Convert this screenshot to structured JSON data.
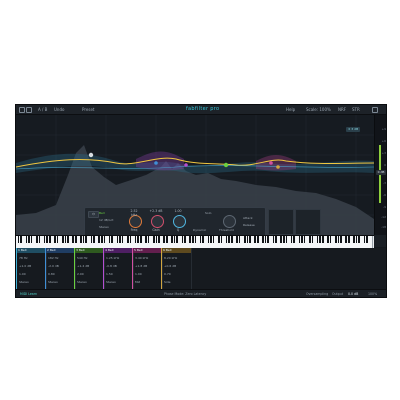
{
  "app": {
    "brand": "fabfilter pro",
    "top_left_items": [
      "A / B",
      "Undo",
      "Preset"
    ],
    "top_right_items": [
      "Help",
      "Scale: 100%",
      "NRF",
      "STR",
      "Help"
    ]
  },
  "display": {
    "gain_badge": "0 dB",
    "topright_badge": "± 3 dB",
    "scale_ticks": [
      "+9",
      "+6",
      "+3",
      "0",
      "-3",
      "-6",
      "-9",
      "-12",
      "-18"
    ]
  },
  "band_panel": {
    "band_label": "Bell",
    "slope_label": "12 dB/oct",
    "stereo_label": "Stereo",
    "knobs": [
      {
        "label": "Freq",
        "value": "2.52 kHz"
      },
      {
        "label": "Gain",
        "value": "+2.3 dB"
      },
      {
        "label": "Q",
        "value": "1.00"
      }
    ],
    "dynamic_label": "Dynamic",
    "threshold_label": "Threshold",
    "attack_label": "Attack",
    "release_label": "Release",
    "solo_label": "Solo"
  },
  "bands": {
    "columns": [
      {
        "head": "1 Bell",
        "color": "#3fb0d6",
        "freq": "78 Hz",
        "gain": "+1.0 dB",
        "q": "1.00",
        "mode": "Stereo"
      },
      {
        "head": "2 Bell",
        "color": "#3f8fd6",
        "freq": "182 Hz",
        "gain": "-2.0 dB",
        "q": "0.80",
        "mode": "Stereo"
      },
      {
        "head": "3 Bell",
        "color": "#6bd13f",
        "freq": "540 Hz",
        "gain": "+1.4 dB",
        "q": "2.00",
        "mode": "Stereo"
      },
      {
        "head": "4 Bell",
        "color": "#b44fd1",
        "freq": "1.25 kHz",
        "gain": "-0.8 dB",
        "q": "1.50",
        "mode": "Stereo"
      },
      {
        "head": "5 Bell",
        "color": "#d14fa0",
        "freq": "3.40 kHz",
        "gain": "+1.8 dB",
        "q": "1.00",
        "mode": "Mid"
      },
      {
        "head": "6 Bell",
        "color": "#d1a53f",
        "freq": "8.20 kHz",
        "gain": "+0.6 dB",
        "q": "0.70",
        "mode": "Side"
      }
    ]
  },
  "bottombar": {
    "left": "MIDI  Learn",
    "center": "Phase Mode: Zero Latency",
    "right_items": [
      "Oversampling",
      "Output",
      "0.0 dB",
      "100%"
    ]
  }
}
